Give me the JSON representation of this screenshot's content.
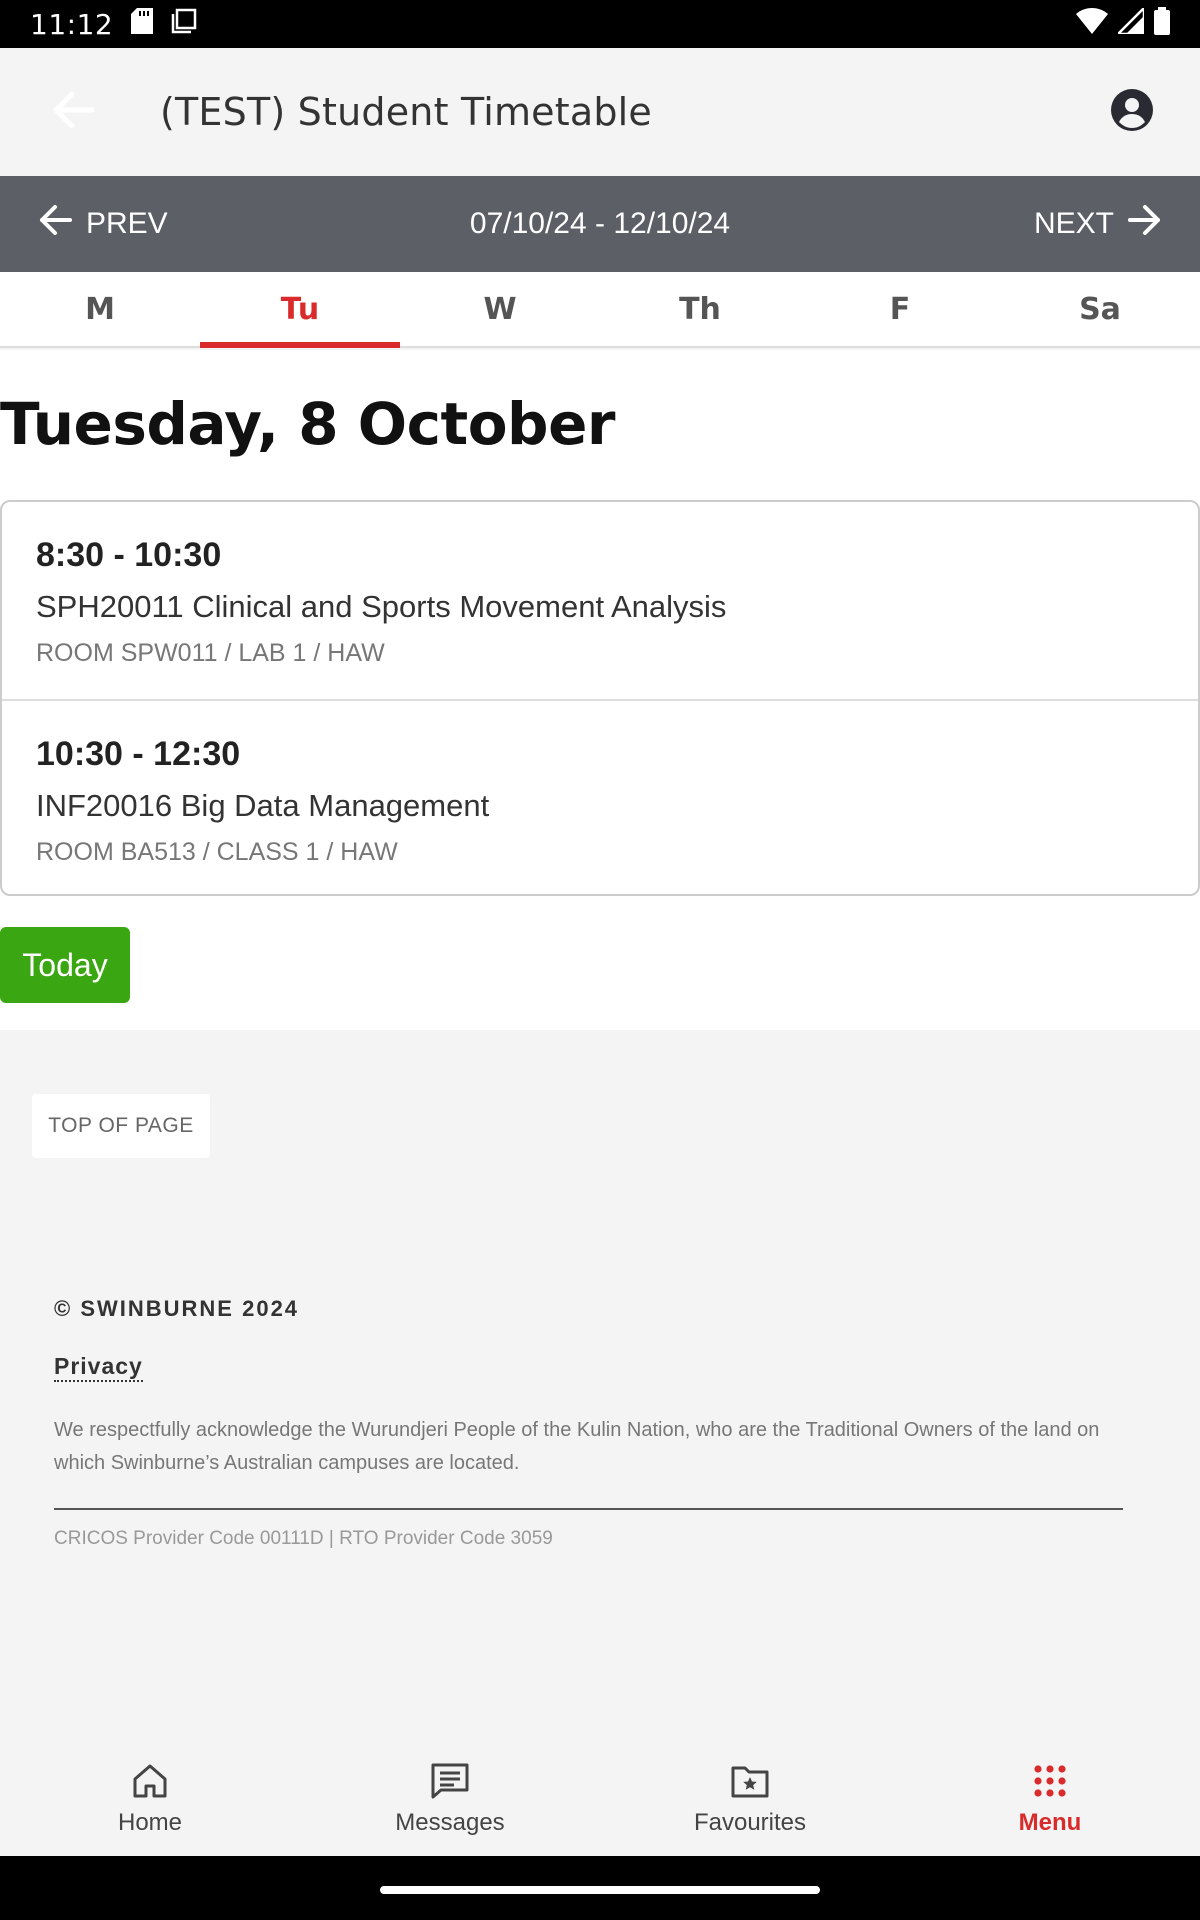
{
  "status_bar": {
    "time": "11:12"
  },
  "app_bar": {
    "title": "(TEST) Student Timetable"
  },
  "week_nav": {
    "prev_label": "PREV",
    "range": "07/10/24 - 12/10/24",
    "next_label": "NEXT"
  },
  "day_tabs": [
    {
      "label": "M",
      "active": false
    },
    {
      "label": "Tu",
      "active": true
    },
    {
      "label": "W",
      "active": false
    },
    {
      "label": "Th",
      "active": false
    },
    {
      "label": "F",
      "active": false
    },
    {
      "label": "Sa",
      "active": false
    }
  ],
  "day_heading": "Tuesday, 8 October",
  "sessions": [
    {
      "time": "8:30 - 10:30",
      "title": "SPH20011 Clinical and Sports Movement Analysis",
      "room": "ROOM SPW011 / LAB 1 / HAW"
    },
    {
      "time": "10:30 - 12:30",
      "title": "INF20016 Big Data Management",
      "room": "ROOM BA513 / CLASS 1 / HAW"
    }
  ],
  "today_button": "Today",
  "footer": {
    "top_of_page": "TOP OF PAGE",
    "copyright": "© SWINBURNE 2024",
    "privacy": "Privacy",
    "acknowledgement": "We respectfully acknowledge the Wurundjeri People of the Kulin Nation, who are the Traditional Owners of the land on which Swinburne’s Australian campuses are located.",
    "cricos": "CRICOS Provider Code 00111D | RTO Provider Code 3059"
  },
  "bottom_nav": {
    "items": [
      {
        "label": "Home",
        "icon": "home-icon",
        "active": false
      },
      {
        "label": "Messages",
        "icon": "messages-icon",
        "active": false
      },
      {
        "label": "Favourites",
        "icon": "favourites-icon",
        "active": false
      },
      {
        "label": "Menu",
        "icon": "menu-grid-icon",
        "active": true
      }
    ]
  },
  "colors": {
    "accent": "#d92b2b",
    "week_bar": "#5c5f66",
    "today_button": "#3aa611"
  }
}
